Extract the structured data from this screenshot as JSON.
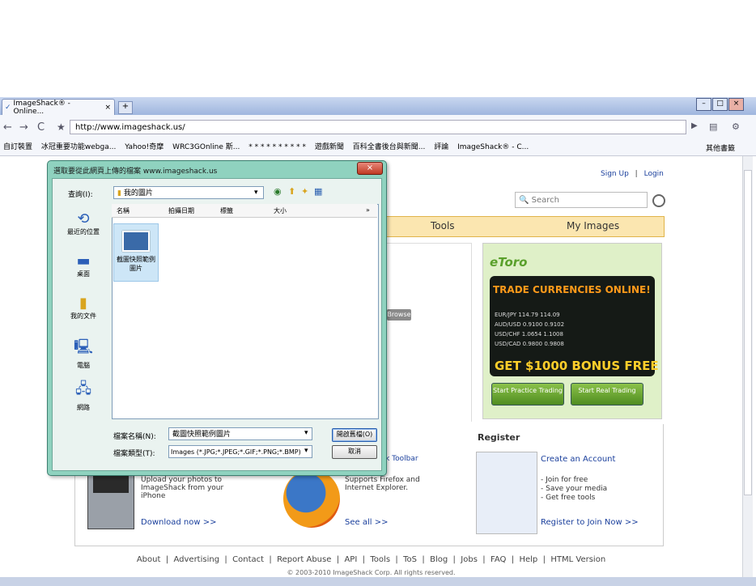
{
  "browser": {
    "tab_title": "ImageShack® - Online...",
    "tab_close": "×",
    "new_tab": "+",
    "url": "http://www.imageshack.us/",
    "bookmarks": [
      "自訂裝置",
      "冰冠重要功能webga...",
      "Yahoo!奇摩",
      "WRC3GOnline 斯...",
      "* * * * * * * * * *",
      "遊戲新聞",
      "百科全書後台與新聞...",
      "評論",
      "ImageShack® - C..."
    ],
    "other_bookmarks": "其他書籤",
    "window_buttons": [
      "–",
      "□",
      "×"
    ]
  },
  "page": {
    "sign_up": "Sign Up",
    "separator": "|",
    "login": "Login",
    "search_placeholder": "Search",
    "nav_tools": "Tools",
    "nav_my_images": "My Images",
    "gray_button": "Browse",
    "ad": {
      "brand": "eToro",
      "headline": "TRADE CURRENCIES ONLINE!",
      "rows": [
        "EUR/JPY   114.79   114.09",
        "AUD/USD   0.9100   0.9102",
        "USD/CHF   1.0654   1.1008",
        "USD/CAD   0.9800   0.9808"
      ],
      "bonus": "GET $1000 BONUS FREE",
      "btn_practice": "Start Practice Trading",
      "btn_real": "Start Real Trading"
    },
    "iphone_text": "Upload your photos to ImageShack from your iPhone",
    "iphone_link": "Download now >>",
    "toolbar_title": "ImageShack Toolbar",
    "toolbar_text": "Supports Firefox and Internet Explorer.",
    "toolbar_link": "See all >>",
    "register_head": "Register",
    "create_account": "Create an Account",
    "register_bullets": [
      "- Join for free",
      "- Save your media",
      "- Get free tools"
    ],
    "register_link": "Register to Join Now >>",
    "footer_links": [
      "About",
      "Advertising",
      "Contact",
      "Report Abuse",
      "API",
      "Tools",
      "ToS",
      "Blog",
      "Jobs",
      "FAQ",
      "Help",
      "HTML Version"
    ],
    "copyright": "© 2003-2010 ImageShack Corp. All rights reserved."
  },
  "dialog": {
    "title": "選取要從此網頁上傳的檔案 www.imageshack.us",
    "close": "×",
    "look_in_label": "查詢(I):",
    "look_in_value": "我的圖片",
    "places": [
      "最近的位置",
      "桌面",
      "我的文件",
      "電腦",
      "網路"
    ],
    "columns": [
      "名稱",
      "拍攝日期",
      "標籤",
      "大小"
    ],
    "file_name": "截圖快照範例圖片",
    "file_name_label": "檔案名稱(N):",
    "file_name_value": "截圖快照範例圖片",
    "file_type_label": "檔案類型(T):",
    "file_type_value": "Images (*.JPG;*.JPEG;*.GIF;*.PNG;*.BMP)",
    "open_button": "開啟舊檔(O)",
    "cancel_button": "取消"
  }
}
